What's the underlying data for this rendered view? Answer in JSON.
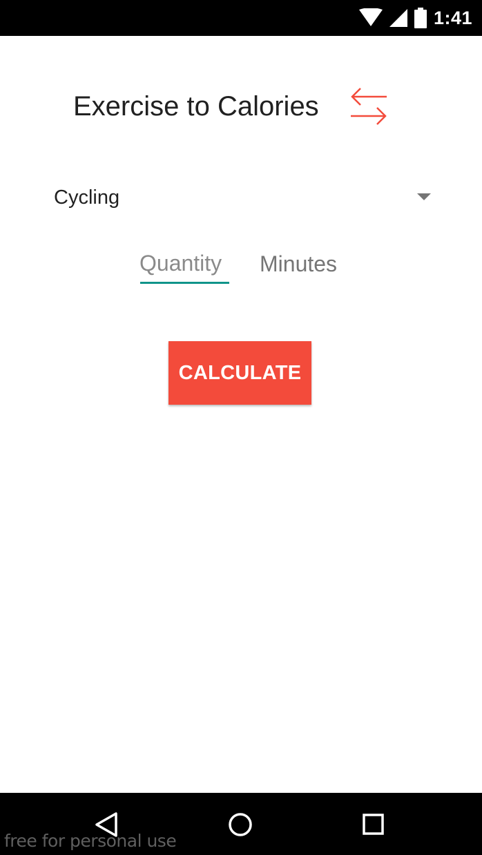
{
  "status_bar": {
    "time": "1:41",
    "icons": [
      "wifi-icon",
      "cell-signal-icon",
      "battery-icon"
    ]
  },
  "header": {
    "title": "Exercise to Calories",
    "swap_icon": "swap-arrows-icon"
  },
  "exercise_spinner": {
    "selected": "Cycling",
    "icon": "dropdown-triangle-icon"
  },
  "quantity": {
    "placeholder": "Quantity",
    "value": ""
  },
  "unit": {
    "label": "Minutes"
  },
  "calculate_button": {
    "label": "CALCULATE"
  },
  "nav_bar": {
    "icons": [
      "back-icon",
      "home-icon",
      "recent-apps-icon"
    ]
  },
  "watermark": {
    "text": "free for personal use"
  },
  "colors": {
    "accent": "#f34b3b",
    "underline": "#10948a",
    "text_primary": "#212121",
    "text_secondary": "#757575"
  }
}
